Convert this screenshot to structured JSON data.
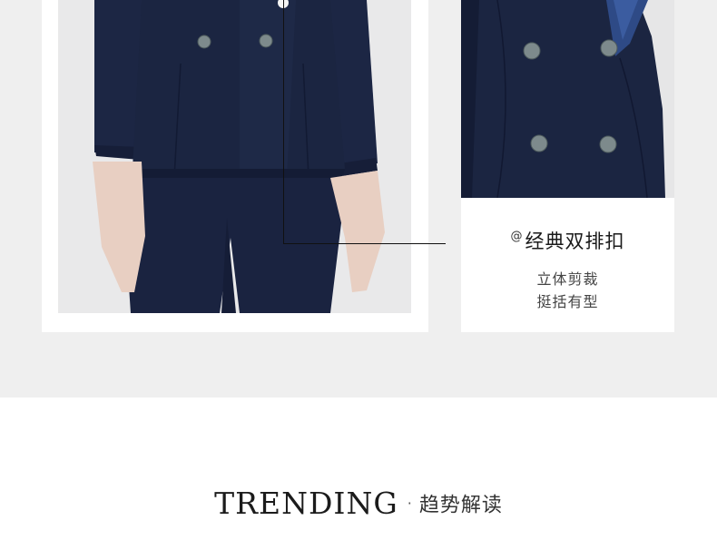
{
  "detail": {
    "at_mark": "@",
    "title": "经典双排扣",
    "line1": "立体剪裁",
    "line2": "挺括有型"
  },
  "section": {
    "title_en": "TRENDING",
    "separator": "·",
    "title_cn": "趋势解读"
  },
  "colors": {
    "band": "#efefef",
    "suit_navy": "#1b2541",
    "lapel_satin": "#2e4a86",
    "text_dark": "#1a1a1a"
  }
}
